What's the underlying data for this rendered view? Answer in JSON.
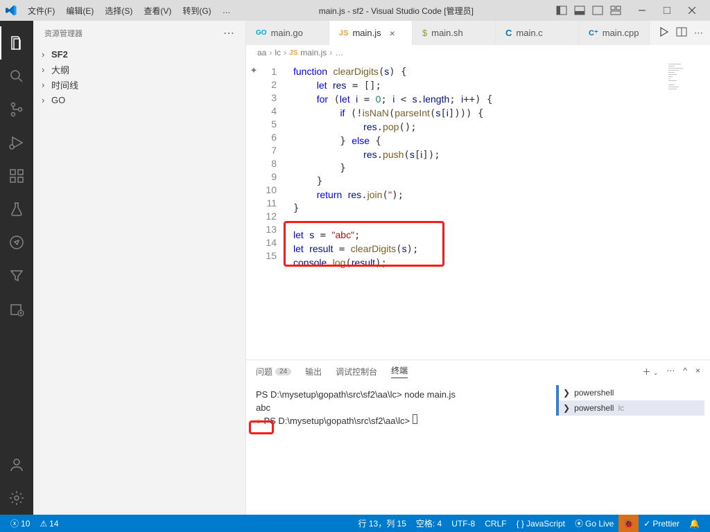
{
  "title": "main.js - sf2 - Visual Studio Code [管理员]",
  "menus": [
    "文件(F)",
    "编辑(E)",
    "选择(S)",
    "查看(V)",
    "转到(G)",
    "…"
  ],
  "sidebar": {
    "title": "资源管理器",
    "items": [
      "SF2",
      "大纲",
      "时间线",
      "GO"
    ]
  },
  "tabs": [
    {
      "icon": "go",
      "label": "main.go",
      "active": false
    },
    {
      "icon": "js",
      "label": "main.js",
      "active": true
    },
    {
      "icon": "sh",
      "label": "main.sh",
      "active": false
    },
    {
      "icon": "c",
      "label": "main.c",
      "active": false
    },
    {
      "icon": "cpp",
      "label": "main.cpp",
      "active": false
    }
  ],
  "breadcrumb": [
    "aa",
    "lc",
    "main.js",
    "…"
  ],
  "code_lines_count": 15,
  "code": {
    "l1": "function clearDigits(s) {",
    "l2": "    let res = [];",
    "l3": "    for (let i = 0; i < s.length; i++) {",
    "l4": "        if (!isNaN(parseInt(s[i]))) {",
    "l5": "            res.pop();",
    "l6": "        } else {",
    "l7": "            res.push(s[i]);",
    "l8": "        }",
    "l9": "    }",
    "l10": "    return res.join('');",
    "l11": "}",
    "l12": "",
    "l13": "let s = \"abc\";",
    "l14": "let result = clearDigits(s);",
    "l15": "console.log(result);"
  },
  "panel": {
    "tabs": [
      {
        "label": "问题",
        "badge": "24"
      },
      {
        "label": "输出"
      },
      {
        "label": "调试控制台"
      },
      {
        "label": "终端",
        "active": true
      }
    ],
    "terminal_sessions": [
      {
        "name": "powershell",
        "color": "#3a7bd5"
      },
      {
        "name": "powershell",
        "sub": "lc",
        "color": "#3a7bd5",
        "active": true
      }
    ],
    "terminal": {
      "line1": "PS D:\\mysetup\\gopath\\src\\sf2\\aa\\lc> node main.js",
      "line2": "abc",
      "line3": "PS D:\\mysetup\\gopath\\src\\sf2\\aa\\lc> "
    }
  },
  "status": {
    "errors": "10",
    "warnings": "14",
    "pos": "行 13，列 15",
    "spaces": "空格: 4",
    "enc": "UTF-8",
    "eol": "CRLF",
    "lang": "JavaScript",
    "golive": "Go Live",
    "prettier": "Prettier"
  }
}
